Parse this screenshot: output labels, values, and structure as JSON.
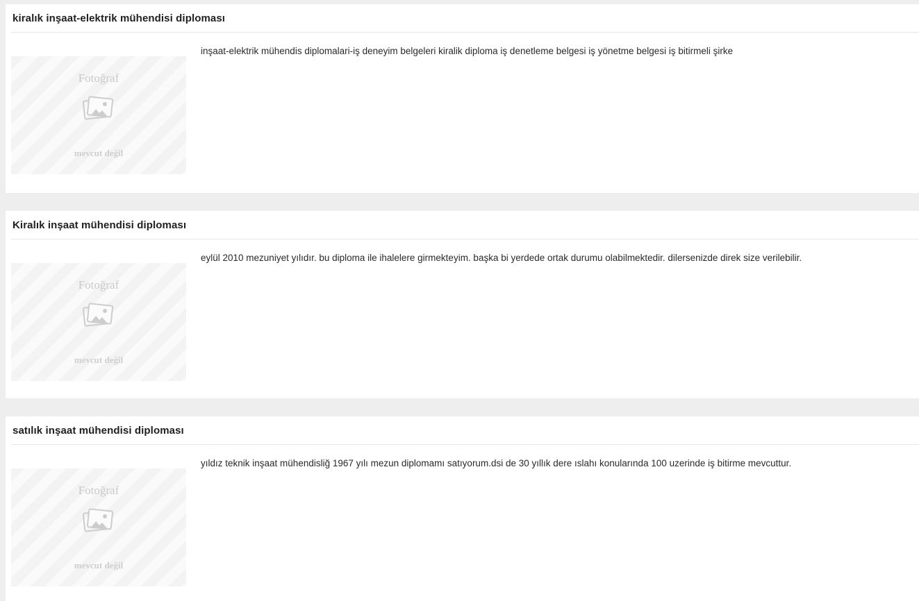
{
  "listings": [
    {
      "title": "kiralık inşaat-elektrik mühendisi diploması",
      "description": "inşaat-elektrik mühendis diplomalari-iş deneyim belgeleri kiralik diploma iş denetleme belgesi iş yönetme belgesi iş bitirmeli şirke",
      "photo": {
        "top_text": "Fotoğraf",
        "bottom_text": "mevcut değil",
        "icon": "image-placeholder-icon"
      }
    },
    {
      "title": "Kiralık inşaat mühendisi diploması",
      "description": "eylül 2010 mezuniyet yılıdır. bu diploma ile ihalelere girmekteyim. başka bi yerdede ortak durumu olabilmektedir. dilersenizde direk size verilebilir.",
      "photo": {
        "top_text": "Fotoğraf",
        "bottom_text": "mevcut değil",
        "icon": "image-placeholder-icon"
      }
    },
    {
      "title": "satılık inşaat mühendisi diploması",
      "description": "yıldız teknik inşaat mühendisliğ 1967 yılı mezun diplomamı satıyorum.dsi de 30 yıllık dere ıslahı konularında 100 uzerinde iş bitirme mevcuttur.",
      "photo": {
        "top_text": "Fotoğraf",
        "bottom_text": "mevcut değil",
        "icon": "image-placeholder-icon"
      }
    }
  ],
  "colors": {
    "page_background": "#eeeeef",
    "card_background": "#ffffff",
    "placeholder_text": "#c9c9c9"
  }
}
